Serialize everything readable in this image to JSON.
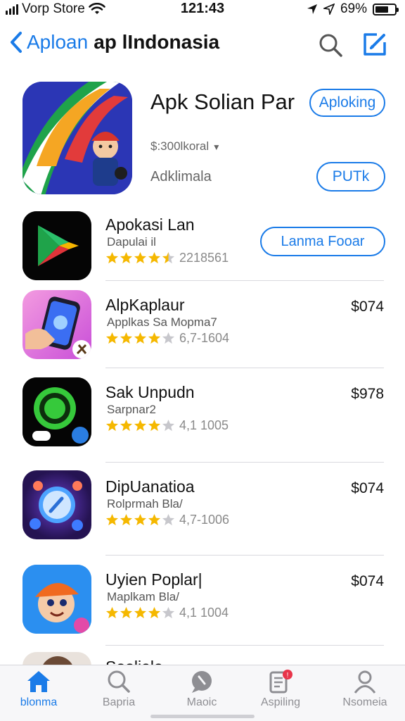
{
  "status_bar": {
    "carrier": "Vorp Store",
    "time": "121:43",
    "battery_percent": "69%",
    "battery_level": 0.69
  },
  "nav": {
    "back_label": "Aploan",
    "title": "ap lIndonasia"
  },
  "featured": {
    "name": "Apk Solian Par",
    "price": "$:300lkoral",
    "subtitle": "Adklimala",
    "get_button": "Aploking",
    "secondary_button": "PUTk"
  },
  "apps": [
    {
      "name": "Apokasi Lan",
      "subtitle": "Dapulai il",
      "rating": 4.5,
      "rating_count": "2218561",
      "action": "Lanma Fooar"
    },
    {
      "name": "AlpKaplaur",
      "subtitle": "Applkas Sa Mopma7",
      "rating": 4,
      "rating_count": "6,7-1604",
      "price": "$074"
    },
    {
      "name": "Sak Unpudn",
      "subtitle": "Sarpnar2",
      "rating": 4,
      "rating_count": "4,1 1005",
      "price": "$978"
    },
    {
      "name": "DipUanatioa",
      "subtitle": "Rolprmah Bla/",
      "rating": 4,
      "rating_count": "4,7-1006",
      "price": "$074"
    },
    {
      "name": "Uyien Poplar|",
      "subtitle": "Maplkam Bla/",
      "rating": 4,
      "rating_count": "4,1 1004",
      "price": "$074"
    },
    {
      "name": "Sooliala"
    }
  ],
  "tabs": [
    {
      "label": "blonma",
      "icon": "home-icon",
      "active": true
    },
    {
      "label": "Bapria",
      "icon": "search-icon",
      "active": false
    },
    {
      "label": "Maoic",
      "icon": "chat-icon",
      "active": false
    },
    {
      "label": "Aspiling",
      "icon": "notes-icon",
      "active": false,
      "badge": "!"
    },
    {
      "label": "Nsomeia",
      "icon": "profile-icon",
      "active": false
    }
  ],
  "colors": {
    "accent": "#1a7be8",
    "star": "#f5b800",
    "star_empty": "#c7c7cc"
  }
}
